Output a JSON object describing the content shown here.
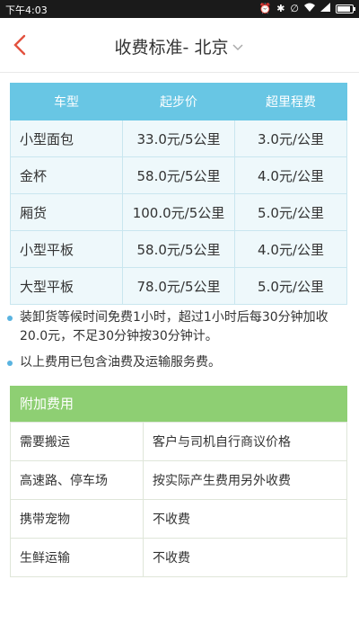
{
  "status_bar": {
    "time": "下午4:03",
    "icons": [
      "alarm-icon",
      "bluetooth-icon",
      "signal-muted-icon",
      "wifi-icon",
      "cellular-icon",
      "battery-icon"
    ],
    "battery_level": 0.85
  },
  "nav": {
    "back_icon": "chevron-left-icon",
    "title": "收费标准- 北京",
    "dropdown_icon": "caret-down-icon",
    "accent_color": "#e3523f"
  },
  "fare_table": {
    "headers": [
      "车型",
      "起步价",
      "超里程费"
    ],
    "header_color": "#68c6e4",
    "rows": [
      [
        "小型面包",
        "33.0元/5公里",
        "3.0元/公里"
      ],
      [
        "金杯",
        "58.0元/5公里",
        "4.0元/公里"
      ],
      [
        "厢货",
        "100.0元/5公里",
        "5.0元/公里"
      ],
      [
        "小型平板",
        "58.0元/5公里",
        "4.0元/公里"
      ],
      [
        "大型平板",
        "78.0元/5公里",
        "5.0元/公里"
      ]
    ]
  },
  "notes": [
    "装卸货等候时间免费1小时，超过1小时后每30分钟加收20.0元，不足30分钟按30分钟计。",
    "以上费用已包含油费及运输服务费。"
  ],
  "extra_fees": {
    "title": "附加费用",
    "header_color": "#8ecf73",
    "rows": [
      [
        "需要搬运",
        "客户与司机自行商议价格"
      ],
      [
        "高速路、停车场",
        "按实际产生费用另外收费"
      ],
      [
        "携带宠物",
        "不收费"
      ],
      [
        "生鲜运输",
        "不收费"
      ]
    ]
  }
}
